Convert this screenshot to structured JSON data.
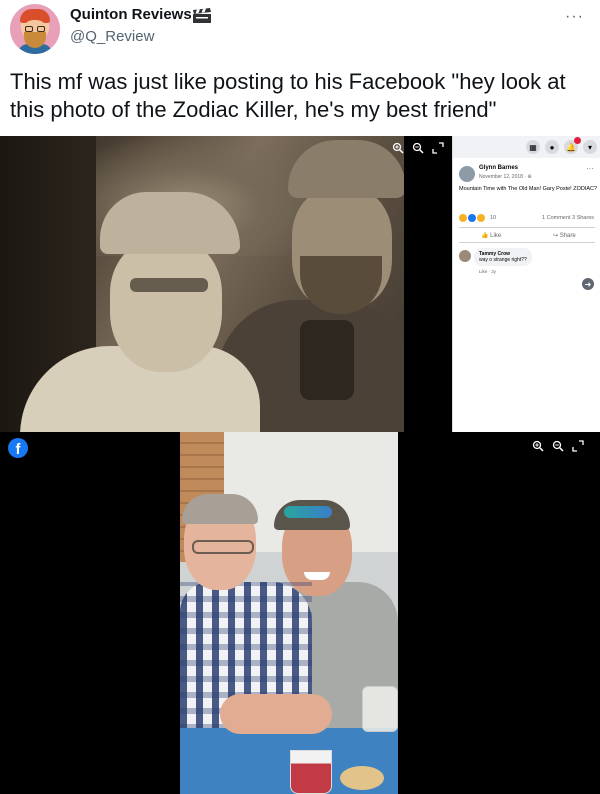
{
  "tweet": {
    "user_name": "Quinton Reviews",
    "user_handle": "@Q_Review",
    "verified_icon": "clapperboard-icon",
    "more_label": "···",
    "text": "This mf was just like posting to his Facebook \"hey look at this photo of the Zodiac Killer, he's my best friend\""
  },
  "facebook_post": {
    "poster": "Glynn Barnes",
    "date": "November 12, 2018 · ⊕",
    "caption": "Mountain Time with The Old Man! Gary Poste! ZODIAC?",
    "reaction_count": "10",
    "stats": "1 Comment  3 Shares",
    "like_label": "Like",
    "share_label": "Share",
    "commenter": "Tammy Crow",
    "comment_text": "way o strange right??",
    "comment_meta": "Like · 2y"
  },
  "icons": {
    "zoom_in": "zoom-in-icon",
    "zoom_out": "zoom-out-icon",
    "expand": "expand-icon",
    "facebook_logo": "facebook-icon",
    "next_arrow": "arrow-right-icon"
  },
  "colors": {
    "facebook_blue": "#1877f2",
    "handle_gray": "#536471",
    "text": "#0f1419"
  }
}
